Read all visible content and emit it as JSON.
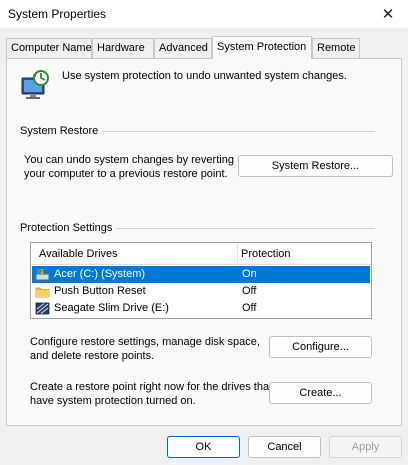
{
  "window": {
    "title": "System Properties",
    "close_glyph": "✕"
  },
  "tabs": [
    {
      "label": "Computer Name"
    },
    {
      "label": "Hardware"
    },
    {
      "label": "Advanced"
    },
    {
      "label": "System Protection"
    },
    {
      "label": "Remote"
    }
  ],
  "active_tab": "System Protection",
  "intro": {
    "text": "Use system protection to undo unwanted system changes.",
    "icon": "system-protection-icon"
  },
  "system_restore": {
    "group_label": "System Restore",
    "description_line1": "You can undo system changes by reverting",
    "description_line2": "your computer to a previous restore point.",
    "button_label": "System Restore..."
  },
  "protection_settings": {
    "group_label": "Protection Settings",
    "columns": [
      "Available Drives",
      "Protection"
    ],
    "drives": [
      {
        "name": "Acer (C:) (System)",
        "protection": "On",
        "icon": "system-drive-icon",
        "selected": true
      },
      {
        "name": "Push Button Reset",
        "protection": "Off",
        "icon": "folder-icon",
        "selected": false
      },
      {
        "name": "Seagate Slim Drive (E:)",
        "protection": "Off",
        "icon": "external-drive-icon",
        "selected": false
      }
    ],
    "configure_text_line1": "Configure restore settings, manage disk space,",
    "configure_text_line2": "and delete restore points.",
    "configure_button": "Configure...",
    "create_text_line1": "Create a restore point right now for the drives that",
    "create_text_line2": "have system protection turned on.",
    "create_button": "Create..."
  },
  "footer": {
    "ok": "OK",
    "cancel": "Cancel",
    "apply": "Apply"
  },
  "colors": {
    "selection": "#0078d7",
    "primary_border": "#0067c0",
    "panel_bg": "#f9f9f9",
    "window_bg": "#f0f0f0"
  }
}
